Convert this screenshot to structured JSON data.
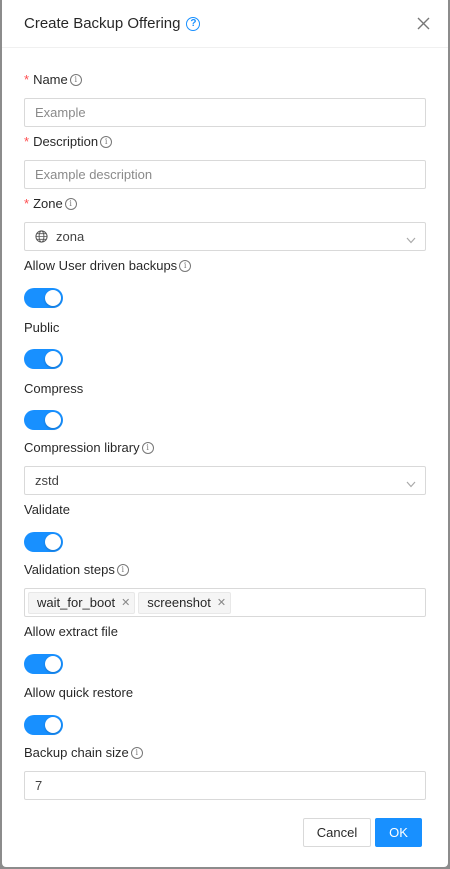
{
  "dialog": {
    "title": "Create Backup Offering",
    "close_icon": "close-icon",
    "help_icon": "question-circle-icon"
  },
  "fields": {
    "name": {
      "label": "Name",
      "required": true,
      "placeholder": "Example"
    },
    "description": {
      "label": "Description",
      "required": true,
      "placeholder": "Example description"
    },
    "zone": {
      "label": "Zone",
      "required": true,
      "value": "zona",
      "icon": "globe-icon"
    },
    "allow_user_driven_backups": {
      "label": "Allow User driven backups",
      "enabled": true
    },
    "public": {
      "label": "Public",
      "enabled": true
    },
    "compress": {
      "label": "Compress",
      "enabled": true
    },
    "compression_library": {
      "label": "Compression library",
      "value": "zstd"
    },
    "validate": {
      "label": "Validate",
      "enabled": true
    },
    "validation_steps": {
      "label": "Validation steps",
      "tags": [
        "wait_for_boot",
        "screenshot"
      ]
    },
    "allow_extract_file": {
      "label": "Allow extract file",
      "enabled": true
    },
    "allow_quick_restore": {
      "label": "Allow quick restore",
      "enabled": true
    },
    "backup_chain_size": {
      "label": "Backup chain size",
      "value": "7"
    }
  },
  "footer": {
    "cancel_label": "Cancel",
    "ok_label": "OK"
  },
  "colors": {
    "primary": "#1890ff",
    "required": "#ff4d4f"
  }
}
